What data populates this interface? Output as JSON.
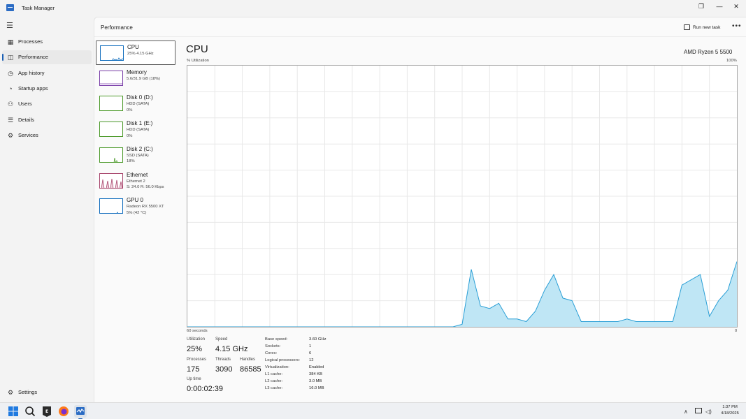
{
  "window": {
    "title": "Task Manager",
    "controls": {
      "minimize": "—",
      "maximize": "❐",
      "close": "✕"
    }
  },
  "nav": {
    "items": [
      {
        "label": "Processes",
        "icon": "grid-icon",
        "glyph": "▦",
        "active": false
      },
      {
        "label": "Performance",
        "icon": "performance-icon",
        "glyph": "◫",
        "active": true
      },
      {
        "label": "App history",
        "icon": "history-icon",
        "glyph": "◷",
        "active": false
      },
      {
        "label": "Startup apps",
        "icon": "speedometer-icon",
        "glyph": "◔",
        "active": false
      },
      {
        "label": "Users",
        "icon": "users-icon",
        "glyph": "⚇",
        "active": false
      },
      {
        "label": "Details",
        "icon": "list-icon",
        "glyph": "☰",
        "active": false
      },
      {
        "label": "Services",
        "icon": "puzzle-icon",
        "glyph": "⚙",
        "active": false
      }
    ],
    "settings": {
      "label": "Settings",
      "icon": "gear-icon",
      "glyph": "⚙"
    }
  },
  "header": {
    "title": "Performance",
    "run_new_task": "Run new task",
    "more": "•••"
  },
  "devices": [
    {
      "name": "CPU",
      "lines": [
        "25% 4.15 GHz"
      ],
      "selected": true,
      "color": "#0f6cbd"
    },
    {
      "name": "Memory",
      "lines": [
        "5.6/31.9 GB (18%)"
      ],
      "selected": false,
      "color": "#7a3fa8"
    },
    {
      "name": "Disk 0 (D:)",
      "lines": [
        "HDD (SATA)",
        "0%"
      ],
      "selected": false,
      "color": "#4c9a2a"
    },
    {
      "name": "Disk 1 (E:)",
      "lines": [
        "HDD (SATA)",
        "0%"
      ],
      "selected": false,
      "color": "#4c9a2a"
    },
    {
      "name": "Disk 2 (C:)",
      "lines": [
        "SSD (SATA)",
        "18%"
      ],
      "selected": false,
      "color": "#4c9a2a"
    },
    {
      "name": "Ethernet",
      "lines": [
        "Ethernet 2",
        "S: 24.0  R: 56.0 Kbps"
      ],
      "selected": false,
      "color": "#a7446b"
    },
    {
      "name": "GPU 0",
      "lines": [
        "Radeon RX 5500 XT",
        "5% (42 °C)"
      ],
      "selected": false,
      "color": "#0f6cbd"
    }
  ],
  "cpu": {
    "title": "CPU",
    "model": "AMD Ryzen 5 5500",
    "y_label": "% Utilization",
    "y_max_label": "100%",
    "x_left_label": "60 seconds",
    "x_right_label": "0",
    "line_color": "#2a9fd6",
    "fill_color": "#bfe6f5",
    "grid_color": "#e8e8e8"
  },
  "chart_data": {
    "type": "area",
    "xlabel": "60 seconds",
    "ylabel": "% Utilization",
    "ylim": [
      0,
      100
    ],
    "x": [
      60,
      59,
      58,
      57,
      56,
      55,
      54,
      53,
      52,
      51,
      50,
      49,
      48,
      47,
      46,
      45,
      44,
      43,
      42,
      41,
      40,
      39,
      38,
      37,
      36,
      35,
      34,
      33,
      32,
      31,
      30,
      29,
      28,
      27,
      26,
      25,
      24,
      23,
      22,
      21,
      20,
      19,
      18,
      17,
      16,
      15,
      14,
      13,
      12,
      11,
      10,
      9,
      8,
      7,
      6,
      5,
      4,
      3,
      2,
      1,
      0
    ],
    "values": [
      0,
      0,
      0,
      0,
      0,
      0,
      0,
      0,
      0,
      0,
      0,
      0,
      0,
      0,
      0,
      0,
      0,
      0,
      0,
      0,
      0,
      0,
      0,
      0,
      0,
      0,
      0,
      0,
      0,
      0,
      1,
      22,
      8,
      7,
      9,
      3,
      3,
      2,
      6,
      14,
      20,
      11,
      10,
      2,
      2,
      2,
      2,
      2,
      3,
      2,
      2,
      2,
      2,
      2,
      16,
      18,
      20,
      4,
      10,
      14,
      25
    ],
    "grid": true
  },
  "stats": {
    "utilization": {
      "label": "Utilization",
      "value": "25%"
    },
    "speed": {
      "label": "Speed",
      "value": "4.15 GHz"
    },
    "processes": {
      "label": "Processes",
      "value": "175"
    },
    "threads": {
      "label": "Threads",
      "value": "3090"
    },
    "handles": {
      "label": "Handles",
      "value": "86585"
    },
    "uptime": {
      "label": "Up time",
      "value": "0:00:02:39"
    }
  },
  "specs": [
    {
      "k": "Base speed:",
      "v": "3.60 GHz"
    },
    {
      "k": "Sockets:",
      "v": "1"
    },
    {
      "k": "Cores:",
      "v": "6"
    },
    {
      "k": "Logical processors:",
      "v": "12"
    },
    {
      "k": "Virtualization:",
      "v": "Enabled"
    },
    {
      "k": "L1 cache:",
      "v": "384 KB"
    },
    {
      "k": "L2 cache:",
      "v": "3.0 MB"
    },
    {
      "k": "L3 cache:",
      "v": "16.0 MB"
    }
  ],
  "taskbar": {
    "apps": [
      {
        "icon": "windows-start-icon"
      },
      {
        "icon": "search-icon"
      },
      {
        "icon": "epic-games-icon"
      },
      {
        "icon": "firefox-icon"
      },
      {
        "icon": "task-manager-icon"
      }
    ],
    "tray": {
      "chevron": "∧",
      "clock_time": "1:37 PM",
      "clock_date": "4/18/2025"
    }
  }
}
